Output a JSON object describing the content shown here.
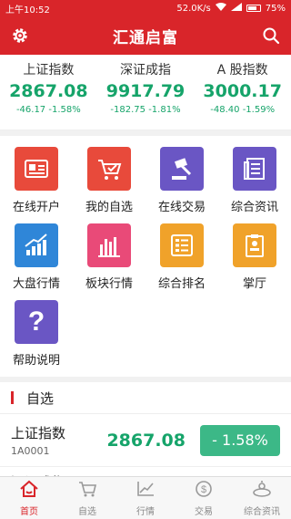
{
  "status": {
    "time": "上午10:52",
    "speed": "52.0K/s",
    "battery": "75%",
    "battery_level": 0.75
  },
  "header": {
    "title": "汇通启富"
  },
  "indices": [
    {
      "name": "上证指数",
      "value": "2867.08",
      "change": "-46.17 -1.58%"
    },
    {
      "name": "深证成指",
      "value": "9917.79",
      "change": "-182.75 -1.81%"
    },
    {
      "name": "A 股指数",
      "value": "3000.17",
      "change": "-48.40 -1.59%"
    }
  ],
  "menu": [
    {
      "label": "在线开户",
      "color": "#e84a3b",
      "icon": "id-card-icon"
    },
    {
      "label": "我的自选",
      "color": "#e84a3b",
      "icon": "cart-icon"
    },
    {
      "label": "在线交易",
      "color": "#6a56c4",
      "icon": "gavel-icon"
    },
    {
      "label": "综合资讯",
      "color": "#6a56c4",
      "icon": "newspaper-icon"
    },
    {
      "label": "大盘行情",
      "color": "#2f86d8",
      "icon": "chart-up-icon"
    },
    {
      "label": "板块行情",
      "color": "#e94a78",
      "icon": "bar-chart-icon"
    },
    {
      "label": "综合排名",
      "color": "#f0a22a",
      "icon": "ranking-list-icon"
    },
    {
      "label": "掌厅",
      "color": "#f0a22a",
      "icon": "clipboard-icon"
    },
    {
      "label": "帮助说明",
      "color": "#6a56c4",
      "icon": "question-icon"
    }
  ],
  "watchlist": {
    "title": "自选",
    "rows": [
      {
        "name": "上证指数",
        "code": "1A0001",
        "price": "2867.08",
        "change": "- 1.58%"
      }
    ],
    "partial_row_name": "深证成指"
  },
  "tabs": [
    {
      "label": "首页",
      "icon": "home-icon",
      "active": true
    },
    {
      "label": "自选",
      "icon": "cart-icon",
      "active": false
    },
    {
      "label": "行情",
      "icon": "trend-icon",
      "active": false
    },
    {
      "label": "交易",
      "icon": "dollar-coin-icon",
      "active": false
    },
    {
      "label": "综合资讯",
      "icon": "news-icon",
      "active": false
    }
  ],
  "colors": {
    "brand_red": "#d9252a",
    "down_green": "#16a46a",
    "badge_green": "#3cb887"
  }
}
